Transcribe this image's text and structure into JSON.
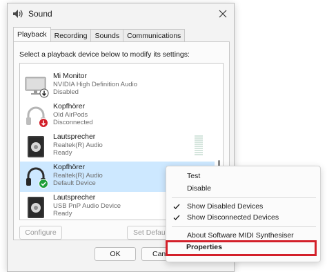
{
  "window": {
    "title": "Sound",
    "app_icon": "speaker-icon",
    "close_icon": "close-icon"
  },
  "tabs": [
    {
      "label": "Playback",
      "active": true
    },
    {
      "label": "Recording",
      "active": false
    },
    {
      "label": "Sounds",
      "active": false
    },
    {
      "label": "Communications",
      "active": false
    }
  ],
  "instruction": "Select a playback device below to modify its settings:",
  "devices": [
    {
      "name": "Mi Monitor",
      "driver": "NVIDIA High Definition Audio",
      "status": "Disabled",
      "icon": "monitor-icon",
      "badge": "down-arrow-badge"
    },
    {
      "name": "Kopfhörer",
      "driver": "Old AirPods",
      "status": "Disconnected",
      "icon": "headphones-icon",
      "badge": "red-down-arrow-badge"
    },
    {
      "name": "Lautsprecher",
      "driver": "Realtek(R) Audio",
      "status": "Ready",
      "icon": "speaker-icon",
      "badge": ""
    },
    {
      "name": "Kopfhörer",
      "driver": "Realtek(R) Audio",
      "status": "Default Device",
      "icon": "headphones-icon",
      "badge": "green-check-badge",
      "selected": true
    },
    {
      "name": "Lautsprecher",
      "driver": "USB PnP Audio Device",
      "status": "Ready",
      "icon": "speaker-icon",
      "badge": ""
    }
  ],
  "buttons": {
    "configure": "Configure",
    "set_default": "Set Default",
    "ok": "OK",
    "cancel": "Canc"
  },
  "context_menu": {
    "items": [
      {
        "label": "Test",
        "checked": false
      },
      {
        "label": "Disable",
        "checked": false
      },
      {
        "label": "Show Disabled Devices",
        "checked": true
      },
      {
        "label": "Show Disconnected Devices",
        "checked": true
      },
      {
        "label": "About Software MIDI Synthesiser",
        "checked": false
      },
      {
        "label": "Properties",
        "checked": false,
        "highlighted": true
      }
    ]
  },
  "colors": {
    "selection": "#cde8ff",
    "highlight_border": "#d3202a",
    "default_badge": "#1f9e3a",
    "disconnected_badge": "#d3202a"
  }
}
